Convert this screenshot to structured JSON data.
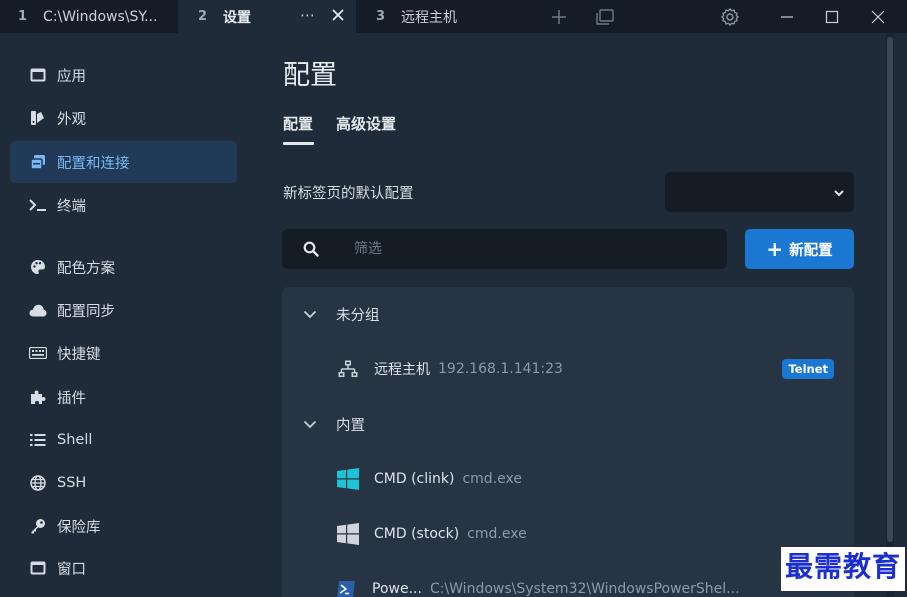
{
  "tabs": [
    {
      "num": "1",
      "title": "C:\\Windows\\SY..."
    },
    {
      "num": "2",
      "title": "设置",
      "more": "⋯"
    },
    {
      "num": "3",
      "title": "远程主机"
    }
  ],
  "sidebar": {
    "items": [
      {
        "label": "应用",
        "icon": "window-icon"
      },
      {
        "label": "外观",
        "icon": "paint-icon"
      },
      {
        "label": "配置和连接",
        "icon": "profiles-icon",
        "active": true
      },
      {
        "label": "终端",
        "icon": "terminal-icon"
      },
      {
        "label": "配色方案",
        "icon": "palette-icon"
      },
      {
        "label": "配置同步",
        "icon": "cloud-icon"
      },
      {
        "label": "快捷键",
        "icon": "keyboard-icon"
      },
      {
        "label": "插件",
        "icon": "puzzle-icon"
      },
      {
        "label": "Shell",
        "icon": "list-icon"
      },
      {
        "label": "SSH",
        "icon": "globe-icon"
      },
      {
        "label": "保险库",
        "icon": "key-icon"
      },
      {
        "label": "窗口",
        "icon": "window-icon"
      }
    ]
  },
  "main": {
    "title": "配置",
    "subtabs": [
      "配置",
      "高级设置"
    ],
    "default_label": "新标签页的默认配置",
    "default_value": "",
    "filter_placeholder": "筛选",
    "new_button": "新配置",
    "groups": [
      {
        "name": "未分组",
        "profiles": [
          {
            "name": "远程主机",
            "desc": "192.168.1.141:23",
            "badge": "Telnet",
            "icon": "network-icon"
          }
        ]
      },
      {
        "name": "内置",
        "profiles": [
          {
            "name": "CMD (clink)",
            "desc": "cmd.exe",
            "icon": "windows-icon-color"
          },
          {
            "name": "CMD (stock)",
            "desc": "cmd.exe",
            "icon": "windows-icon-gray"
          },
          {
            "name": "Powe...",
            "desc": "C:\\Windows\\System32\\WindowsPowerShel...",
            "icon": "powershell-icon"
          }
        ]
      }
    ]
  },
  "watermark": "最需教育",
  "colors": {
    "accent": "#1a78d3",
    "active_bg": "#213a57",
    "active_text": "#79b8f5",
    "bg": "#1f2b38",
    "titlebar": "#141d27"
  }
}
